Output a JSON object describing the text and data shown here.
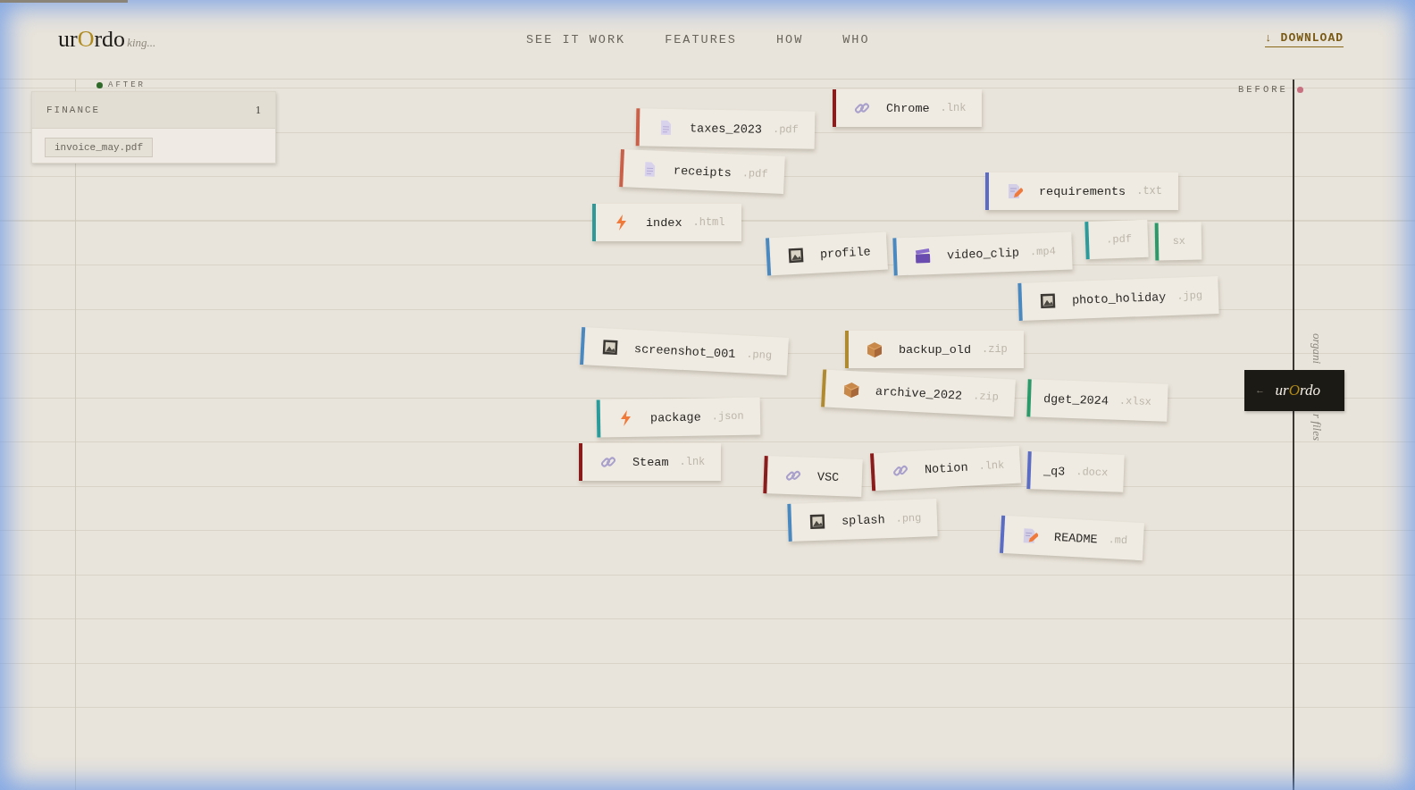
{
  "header": {
    "logo": "urOrdo",
    "faded_caption": "king...",
    "nav": [
      "SEE IT WORK",
      "FEATURES",
      "HOW",
      "WHO"
    ],
    "download": {
      "arrow": "↓",
      "label": "DOWNLOAD"
    }
  },
  "after": {
    "label": "AFTER",
    "color": "#2f6a2a"
  },
  "before": {
    "label": "BEFORE",
    "color": "#c87080"
  },
  "folder": {
    "title": "FINANCE",
    "count": "1",
    "files": [
      "invoice_may.pdf"
    ]
  },
  "cards": [
    {
      "kind": "link",
      "name": "Chrome",
      "ext": ".lnk",
      "color": "#8a1c1c"
    },
    {
      "kind": "document",
      "name": "taxes_2023",
      "ext": ".pdf",
      "color": "#c8604a"
    },
    {
      "kind": "document",
      "name": "receipts",
      "ext": ".pdf",
      "color": "#c8604a"
    },
    {
      "kind": "note",
      "name": "requirements",
      "ext": ".txt",
      "color": "#5a6cc4"
    },
    {
      "kind": "script",
      "name": "index",
      "ext": ".html",
      "color": "#2a9a9a"
    },
    {
      "kind": "fragment",
      "ext": ".pdf",
      "color": "#2a9a9a"
    },
    {
      "kind": "fragment",
      "ext": "sx",
      "color": "#2a9a6a"
    },
    {
      "kind": "image",
      "name": "profile",
      "color": "#4a88c0"
    },
    {
      "kind": "video",
      "name": "video_clip",
      "ext": ".mp4",
      "color": "#4a88c0"
    },
    {
      "kind": "image",
      "name": "photo_holiday",
      "ext": ".jpg",
      "color": "#4a88c0"
    },
    {
      "kind": "image",
      "name": "screenshot_001",
      "ext": ".png",
      "color": "#4a88c0"
    },
    {
      "kind": "fragment",
      "name": "dget_2024",
      "ext": ".xlsx",
      "color": "#2a9a6a"
    },
    {
      "kind": "archive",
      "name": "backup_old",
      "ext": ".zip",
      "color": "#b08a30"
    },
    {
      "kind": "archive",
      "name": "archive_2022",
      "ext": ".zip",
      "color": "#b08a30"
    },
    {
      "kind": "script",
      "name": "package",
      "ext": ".json",
      "color": "#2a9a9a"
    },
    {
      "kind": "link",
      "name": "Steam",
      "ext": ".lnk",
      "color": "#8a1c1c"
    },
    {
      "kind": "link",
      "name": "VSC",
      "color": "#8a1c1c"
    },
    {
      "kind": "image",
      "name": "splash",
      "ext": ".png",
      "color": "#4a88c0"
    },
    {
      "kind": "fragment",
      "name": "_q3",
      "ext": ".docx",
      "color": "#5a6cc4"
    },
    {
      "kind": "link",
      "name": "Notion",
      "ext": ".lnk",
      "color": "#8a1c1c"
    },
    {
      "kind": "note",
      "name": "README",
      "ext": ".md",
      "color": "#5a6cc4"
    }
  ],
  "tag": {
    "arrow": "←",
    "brand": "urOrdo"
  },
  "side_caption": [
    "organi",
    "r files"
  ]
}
